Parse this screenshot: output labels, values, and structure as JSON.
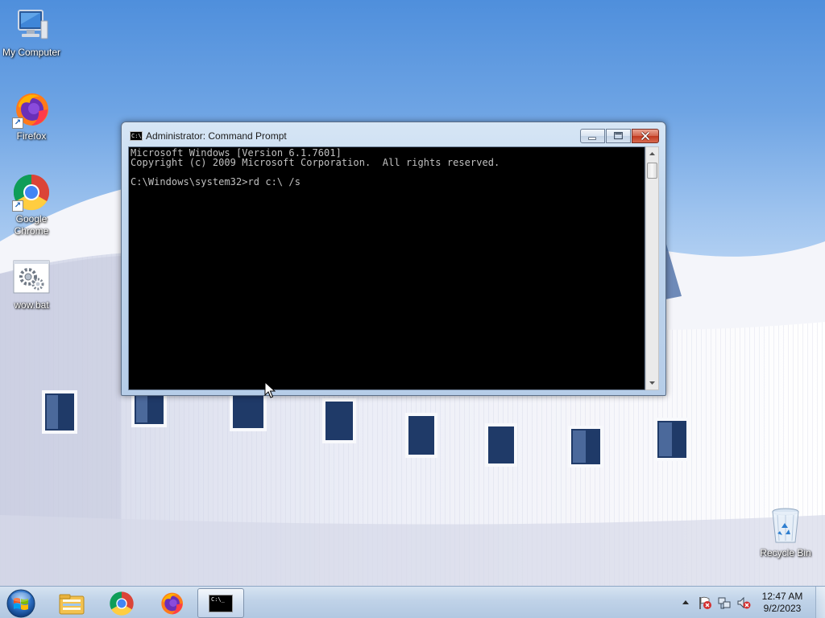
{
  "desktop": {
    "icons": [
      {
        "label": "My Computer",
        "icon": "computer-icon"
      },
      {
        "label": "Firefox",
        "icon": "firefox-icon"
      },
      {
        "label": "Google Chrome",
        "icon": "chrome-icon"
      },
      {
        "label": "wow.bat",
        "icon": "batch-file-icon"
      },
      {
        "label": "Recycle Bin",
        "icon": "recycle-bin-icon"
      }
    ]
  },
  "cmd_window": {
    "title": "Administrator:  Command Prompt",
    "icon_text": "C:\\.",
    "lines": [
      "Microsoft Windows [Version 6.1.7601]",
      "Copyright (c) 2009 Microsoft Corporation.  All rights reserved.",
      "",
      "C:\\Windows\\system32>rd c:\\ /s"
    ],
    "buttons": {
      "minimize": "minimize-icon",
      "maximize": "maximize-icon",
      "close": "close-icon"
    }
  },
  "taskbar": {
    "start": "windows-start-icon",
    "pinned": [
      "file-explorer-icon",
      "chrome-icon",
      "firefox-icon",
      "command-prompt-icon"
    ],
    "active_item": "command-prompt-icon",
    "cmd_icon_text": "C:\\_",
    "tray": {
      "icons": [
        "show-hidden-icons-arrow",
        "action-center-flag-icon",
        "network-icon",
        "volume-muted-icon"
      ]
    },
    "clock": {
      "time": "12:47 AM",
      "date": "9/2/2023"
    }
  },
  "colors": {
    "sky": "#6ea4e4",
    "titlebar": "#c0d6ee",
    "console_bg": "#000000",
    "console_fg": "#c0c0c0",
    "close_button": "#c0381f",
    "taskbar": "#bed2e8"
  }
}
